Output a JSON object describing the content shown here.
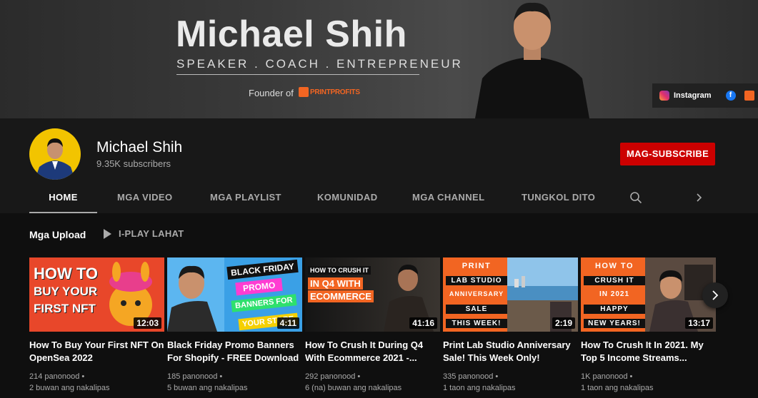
{
  "banner": {
    "name": "Michael Shih",
    "tagline": "SPEAKER . COACH . ENTREPRENEUR",
    "founder_label": "Founder of",
    "brand": "PRINTPROFITS",
    "socials": {
      "instagram_label": "Instagram",
      "facebook_glyph": "f"
    }
  },
  "channel": {
    "name": "Michael Shih",
    "subscribers": "9.35K subscribers",
    "subscribe_label": "MAG-SUBSCRIBE"
  },
  "tabs": [
    "HOME",
    "MGA VIDEO",
    "MGA PLAYLIST",
    "KOMUNIDAD",
    "MGA CHANNEL",
    "TUNGKOL DITO"
  ],
  "section": {
    "title": "Mga Upload",
    "play_all": "I-PLAY LAHAT"
  },
  "videos": [
    {
      "title": "How To Buy Your First NFT On OpenSea 2022",
      "duration": "12:03",
      "views": "214 panonood •",
      "age": "2 buwan ang nakalipas",
      "thumb_text": [
        "HOW TO",
        "BUY YOUR",
        "FIRST NFT"
      ]
    },
    {
      "title": "Black Friday Promo Banners For Shopify - FREE Download",
      "duration": "4:11",
      "views": "185 panonood •",
      "age": "5 buwan ang nakalipas",
      "thumb_text": [
        "BLACK FRIDAY",
        "PROMO",
        "BANNERS FOR",
        "YOUR STORE"
      ]
    },
    {
      "title": "How To Crush It During Q4 With Ecommerce 2021 -...",
      "duration": "41:16",
      "views": "292 panonood •",
      "age": "6 (na) buwan ang nakalipas",
      "thumb_text": [
        "HOW TO CRUSH IT",
        "IN Q4 WITH",
        "ECOMMERCE"
      ]
    },
    {
      "title": "Print Lab Studio Anniversary Sale! This Week Only!",
      "duration": "2:19",
      "views": "335 panonood •",
      "age": "1 taon ang nakalipas",
      "thumb_text": [
        "PRINT",
        "LAB STUDIO",
        "ANNIVERSARY",
        "SALE",
        "THIS WEEK!"
      ]
    },
    {
      "title": "How To Crush It In 2021. My Top 5 Income Streams...",
      "duration": "13:17",
      "views": "1K panonood •",
      "age": "1 taon ang nakalipas",
      "thumb_text": [
        "HOW TO",
        "CRUSH IT",
        "IN 2021",
        "HAPPY",
        "NEW YEARS!"
      ]
    }
  ],
  "colors": {
    "subscribe": "#cc0000",
    "brand_orange": "#f26522",
    "avatar_bg": "#f2c400"
  },
  "icons": [
    "instagram-icon",
    "facebook-icon",
    "printprofits-icon",
    "search-icon",
    "chevron-right-icon",
    "play-icon"
  ]
}
